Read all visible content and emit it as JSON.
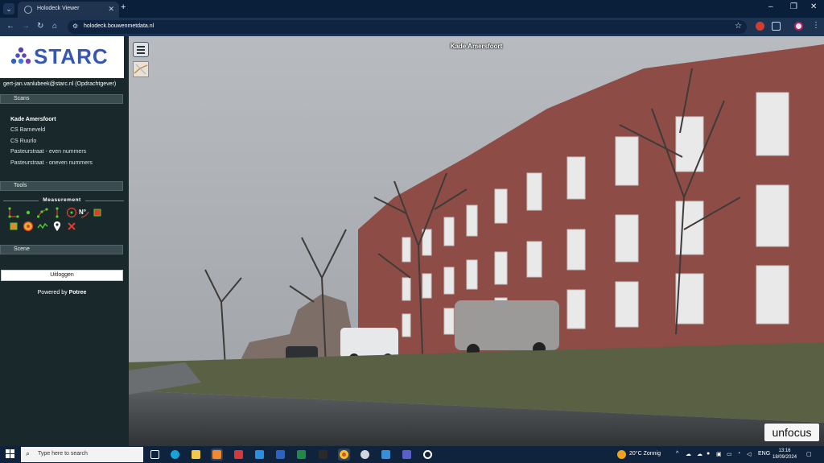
{
  "browser": {
    "tab_title": "Holodeck Viewer",
    "new_tab_label": "+",
    "url": "holodeck.bouwenmetdata.nl",
    "window_controls": [
      "–",
      "❐",
      "✕"
    ]
  },
  "brand": {
    "logo_text": "STARC",
    "logo_color": "#3656b6"
  },
  "sidebar": {
    "user": "gert-jan.vanlubeek@starc.nl (Opdrachtgever)",
    "sections": {
      "scans": "Scans",
      "tools": "Tools",
      "scene": "Scene"
    },
    "scans": [
      {
        "label": "Kade Amersfoort",
        "active": true
      },
      {
        "label": "CS Barneveld",
        "active": false
      },
      {
        "label": "CS Ruurlo",
        "active": false
      },
      {
        "label": "Pasteurstraat - even nummers",
        "active": false
      },
      {
        "label": "Pasteurstraat - oneven nummers",
        "active": false
      }
    ],
    "measurement_label": "Measurement",
    "measurement_tools": [
      "angle-icon",
      "point-icon",
      "distance-icon",
      "height-icon",
      "circle-icon",
      "azimuth-icon",
      "area-icon",
      "volume-icon",
      "sphere-volume-icon",
      "profile-icon",
      "annotation-icon",
      "remove-measurements-icon"
    ],
    "logout_label": "Uitloggen",
    "powered_prefix": "Powered by",
    "powered_brand": "Potree"
  },
  "viewer": {
    "scene_title": "Kade Amersfoort",
    "unfocus_label": "unfocus"
  },
  "taskbar": {
    "search_placeholder": "Type here to search",
    "weather": "20°C  Zonnig",
    "language": "ENG",
    "time": "13:16",
    "date": "18/09/2024"
  }
}
